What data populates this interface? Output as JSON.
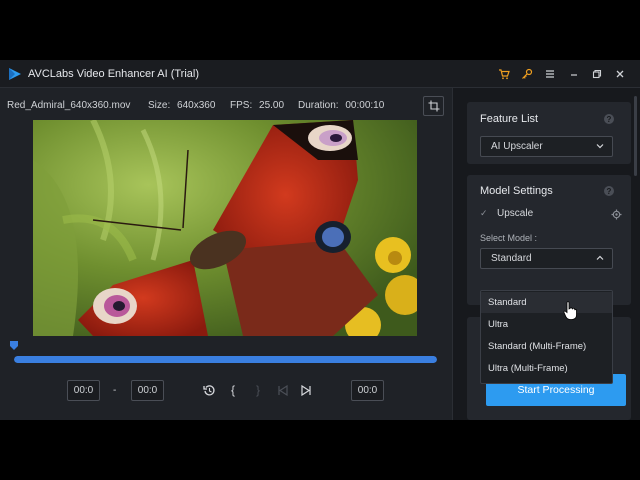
{
  "titlebar": {
    "app_title": "AVCLabs Video Enhancer AI (Trial)",
    "icons": [
      "cart-icon",
      "key-icon",
      "menu-icon",
      "minimize-icon",
      "restore-icon",
      "close-icon"
    ],
    "accent": "#f0a020"
  },
  "file_info": {
    "filename": "Red_Admiral_640x360.mov",
    "size_label": "Size:",
    "size_value": "640x360",
    "fps_label": "FPS:",
    "fps_value": "25.00",
    "duration_label": "Duration:",
    "duration_value": "00:00:10"
  },
  "timeline": {
    "progress": 1.0,
    "start_time": "00:0",
    "end_time": "00:0",
    "dash": "-",
    "current_time": "00:0",
    "open_bracket": "{",
    "close_bracket": "}",
    "progress_color": "#3a7fe0"
  },
  "feature_list": {
    "title": "Feature List",
    "help": "?",
    "selected": "AI Upscaler"
  },
  "model_settings": {
    "title": "Model Settings",
    "help": "?",
    "upscale_label": "Upscale",
    "checkmark": "✓",
    "select_model_label": "Select Model :",
    "selected_model": "Standard",
    "options": [
      "Standard",
      "Ultra",
      "Standard (Multi-Frame)",
      "Ultra (Multi-Frame)"
    ]
  },
  "actions": {
    "start_label": "Start Processing",
    "start_color": "#2d9bf0"
  }
}
